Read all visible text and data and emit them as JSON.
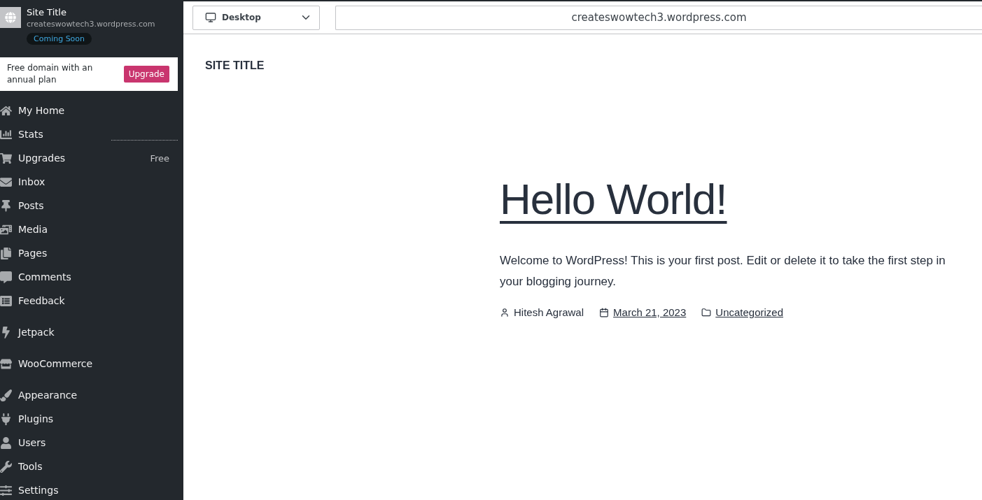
{
  "site": {
    "title": "Site Title",
    "url": "createswowtech3.wordpress.com",
    "status": "Coming Soon"
  },
  "promo": {
    "text": "Free domain with an annual plan",
    "button": "Upgrade"
  },
  "menu_groups": [
    {
      "items": [
        {
          "label": "My Home"
        },
        {
          "label": "Stats"
        },
        {
          "label": "Upgrades",
          "badge": "Free"
        },
        {
          "label": "Inbox"
        },
        {
          "label": "Posts"
        },
        {
          "label": "Media"
        },
        {
          "label": "Pages"
        },
        {
          "label": "Comments"
        },
        {
          "label": "Feedback"
        }
      ]
    },
    {
      "items": [
        {
          "label": "Jetpack"
        }
      ]
    },
    {
      "items": [
        {
          "label": "WooCommerce"
        }
      ]
    },
    {
      "items": [
        {
          "label": "Appearance"
        },
        {
          "label": "Plugins"
        },
        {
          "label": "Users"
        },
        {
          "label": "Tools"
        },
        {
          "label": "Settings"
        }
      ]
    }
  ],
  "toolbar": {
    "device": "Desktop",
    "address": "createswowtech3.wordpress.com"
  },
  "preview": {
    "site_title": "SITE TITLE",
    "post_title": "Hello World!",
    "excerpt": "Welcome to WordPress! This is your first post. Edit or delete it to take the first step in your blogging journey.",
    "author": "Hitesh Agrawal",
    "date": "March 21, 2023",
    "category": "Uncategorized"
  }
}
